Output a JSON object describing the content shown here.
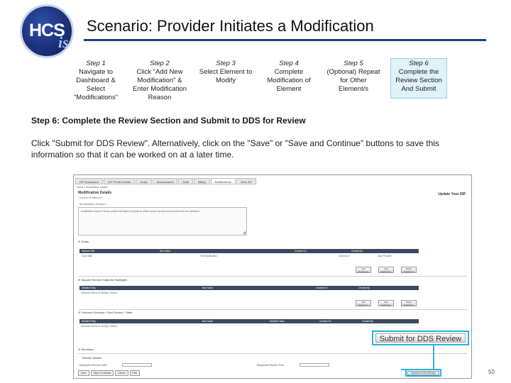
{
  "logo": {
    "main": "HCS",
    "sub": "is"
  },
  "slide": {
    "title": "Scenario: Provider Initiates a Modification",
    "page_number": "50"
  },
  "steps": [
    {
      "num": "Step 1",
      "text": "Navigate to Dashboard & Select \"Modifications\""
    },
    {
      "num": "Step 2",
      "text": "Click \"Add New Modification\" & Enter Modification Reason"
    },
    {
      "num": "Step 3",
      "text": "Select Element to Modify"
    },
    {
      "num": "Step 4",
      "text": "Complete Modification of Element"
    },
    {
      "num": "Step 5",
      "text": "(Optional) Repeat for Other Element/s"
    },
    {
      "num": "Step 6",
      "text": "Complete the Review Section And Submit"
    }
  ],
  "section_heading": "Step 6: Complete the Review Section and Submit to DDS for Review",
  "description": "Click \"Submit for DDS Review\". Alternatively, click on the \"Save\" or \"Save and Continue\" buttons to save this information so that it can be worked on at a later time.",
  "screenshot": {
    "tabs": [
      "ISP Dashboard",
      "ISP Profile Details",
      "Goals",
      "Assessments",
      "Data",
      "Billing",
      "Modifications",
      "View ISP"
    ],
    "active_tab": 6,
    "breadcrumb": "Home > Modification Details",
    "page_title": "Modification Details",
    "update_link": "Update Your ISP",
    "id_line": "Current ID   Status: IP",
    "reason_label": "Modification Reason *",
    "reason_text": "Modification reason: Please update information for goals to reflect current services and outcomes for the individual.",
    "goals_section": "Goals",
    "goals_columns": [
      "Element Title",
      "New Value",
      "Created On",
      "Created By"
    ],
    "goals_row": [
      "Goal: BBB",
      "Text Modification",
      "10/10/2017",
      "Jane Provider"
    ],
    "support_section": "Support Service Supports Strategies",
    "support_columns": [
      "Detailed Entry",
      "New Value",
      "Created On",
      "Created By"
    ],
    "support_empty": "Selected Items to Modify: Strand",
    "outcome_section": "Outcome Services / Fund Source / Other",
    "outcome_columns": [
      "Detailed Entry",
      "New Value",
      "Modified Value",
      "Created On",
      "Created By"
    ],
    "outcome_empty": "Selected Items to Modify: Strand",
    "mini_buttons": [
      "Add Modification",
      "View Modification",
      "Delete Modification"
    ],
    "submit_button_large": "Submit for DDS Review",
    "summary_section": "Summary",
    "review_section": "Review Section",
    "review_label_1": "Requested Review Date *",
    "review_label_2": "Requested Review Time",
    "footer_buttons": [
      "Save",
      "Save & Continue",
      "Cancel",
      "Print"
    ],
    "footer_right_button": "Submit for DDS Review"
  }
}
